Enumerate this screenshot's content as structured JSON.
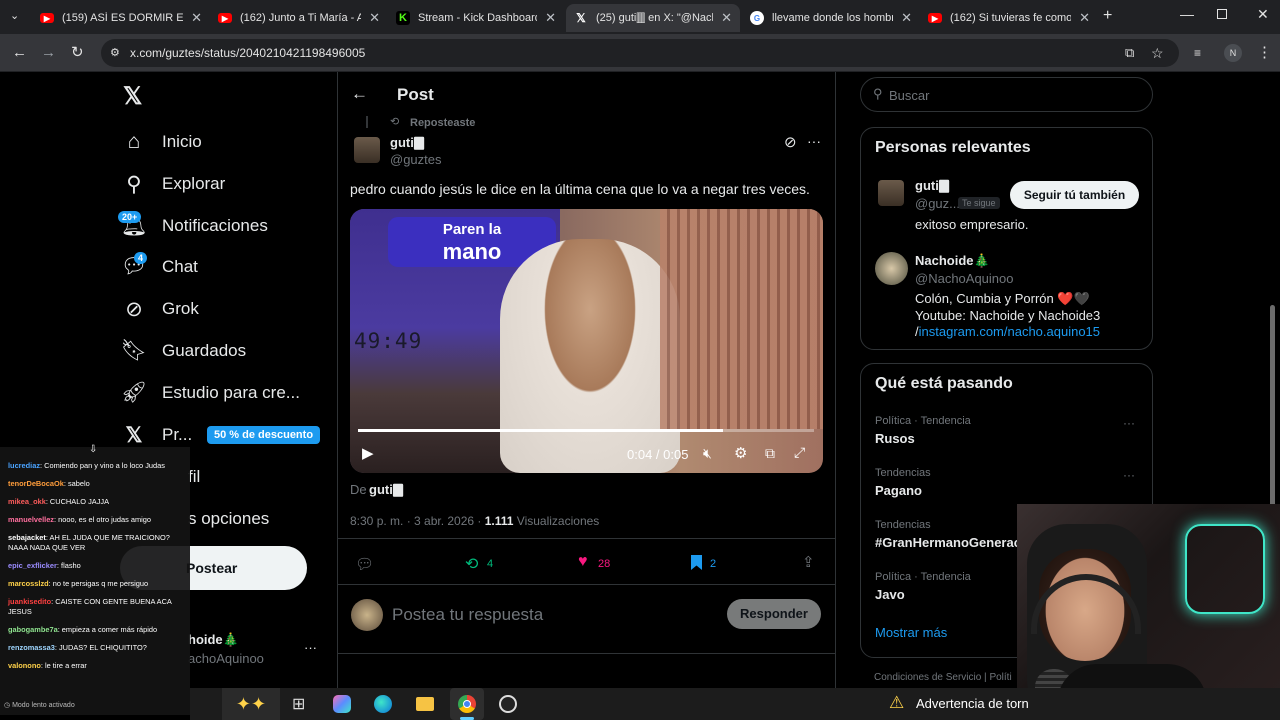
{
  "browser": {
    "tabs": [
      {
        "title": "(159) ASÍ ES DORMIR EN E",
        "color": "#ff0000"
      },
      {
        "title": "(162) Junto a Ti María - Ati",
        "color": "#ff0000"
      },
      {
        "title": "Stream - Kick Dashboard",
        "color": "#53fc18"
      },
      {
        "title": "(25) guti🀫 en X: \"@NachoA",
        "color": "#000000"
      },
      {
        "title": "llevame donde los hombre",
        "color": "#4285f4"
      },
      {
        "title": "(162) Si tuvieras fe como u",
        "color": "#ff0000"
      }
    ],
    "url": "x.com/guztes/status/2040210421198496005",
    "profile_initial": "N"
  },
  "nav": {
    "items": [
      {
        "label": "Inicio",
        "icon": "home-icon"
      },
      {
        "label": "Explorar",
        "icon": "search-icon"
      },
      {
        "label": "Notificaciones",
        "icon": "bell-icon",
        "badge": "20+"
      },
      {
        "label": "Chat",
        "icon": "chat-icon",
        "badge": "4"
      },
      {
        "label": "Grok",
        "icon": "grok-icon"
      },
      {
        "label": "Guardados",
        "icon": "bookmark-icon"
      },
      {
        "label": "Estudio para cre...",
        "icon": "rocket-icon"
      },
      {
        "label": "Pr...",
        "icon": "x-icon"
      },
      {
        "label": "fil",
        "icon": "profile-icon"
      },
      {
        "label": "s opciones",
        "icon": "more-icon"
      }
    ],
    "premium_badge": "50 % de descuento",
    "post_button": "Postear",
    "account_name": "hoide🎄",
    "account_handle": "achoAquinoo"
  },
  "post": {
    "header_title": "Post",
    "reposted_label": "Reposteaste",
    "author_name": "guti🀫",
    "author_handle": "@guztes",
    "text": "pedro cuando jesús le dice en la última cena que lo va a negar tres veces.",
    "video_sign_top": "Paren la",
    "video_sign_bottom": "mano",
    "video_timer": "49:49",
    "video_time": "0:04 / 0:05",
    "video_progress": 0.8,
    "from_label": "De",
    "from_author": "guti🀫",
    "timestamp": "8:30 p. m. · 3 abr. 2026 · ",
    "views": "1.111",
    "views_label": " Visualizaciones",
    "reposts": "4",
    "likes": "28",
    "bookmarks": "2",
    "reply_placeholder": "Postea tu respuesta",
    "reply_button": "Responder"
  },
  "sidebar": {
    "search_placeholder": "Buscar",
    "relevant_title": "Personas relevantes",
    "person1": {
      "name": "guti🀫",
      "handle": "@guz...",
      "follows_you": "Te sigue",
      "button": "Seguir tú también",
      "bio": "exitoso empresario."
    },
    "person2": {
      "name": "Nachoide🎄",
      "handle": "@NachoAquinoo",
      "bio_line1": "Colón, Cumbia y Porrón ❤️🖤",
      "bio_line2": "Youtube: Nachoide y Nachoide3",
      "bio_line3_prefix": "/",
      "bio_link": "instagram.com/nacho.aquino15"
    },
    "trending_title": "Qué está pasando",
    "trends": [
      {
        "category": "Política · Tendencia",
        "name": "Rusos"
      },
      {
        "category": "Tendencias",
        "name": "Pagano"
      },
      {
        "category": "Tendencias",
        "name": "#GranHermanoGenerac"
      },
      {
        "category": "Política · Tendencia",
        "name": "Javo"
      }
    ],
    "show_more": "Mostrar más",
    "footer_terms": "Condiciones de Servicio",
    "footer_more": "Políti"
  },
  "chat": {
    "messages": [
      {
        "user": "lucrediaz",
        "text": ": Comiendo pan y vino a lo loco Judas",
        "color": "#4aa3ff"
      },
      {
        "user": "tenorDeBocaOk",
        "text": ": sabelo",
        "color": "#ff9d3b"
      },
      {
        "user": "mikea_okk",
        "text": ": CUCHALO JAJJA",
        "color": "#ff5c5c"
      },
      {
        "user": "manuelvellez",
        "text": ": nooo, es el otro judas amigo",
        "color": "#ff6f9e"
      },
      {
        "user": "sebajacket",
        "text": ": AH EL JUDA QUE ME TRAICIONO? NAAA NADA QUE VER",
        "color": "#ffffff"
      },
      {
        "user": "epic_exflicker",
        "text": ": flasho",
        "color": "#9b8cff"
      },
      {
        "user": "marcosslzd",
        "text": ": no te persigas q me persiguo",
        "color": "#ffd24a"
      },
      {
        "user": "juankisedito",
        "text": ": CAISTE CON GENTE BUENA ACA JESUS",
        "color": "#ff4040"
      },
      {
        "user": "gabogambe7a",
        "text": ": empieza a comer más rápido",
        "color": "#8fe38f"
      },
      {
        "user": "renzomassa3",
        "text": ": JUDAS? EL CHIQUITITO?",
        "color": "#9fd6ff"
      },
      {
        "user": "valonono",
        "text": ": le tire a errar",
        "color": "#ffd24a"
      }
    ],
    "slow_mode": "Modo lento activado"
  },
  "taskbar": {
    "weather_text": "Advertencia de torn"
  },
  "colors": {
    "accent": "#1d9bf0",
    "like": "#f91880",
    "repost": "#00ba7c"
  }
}
